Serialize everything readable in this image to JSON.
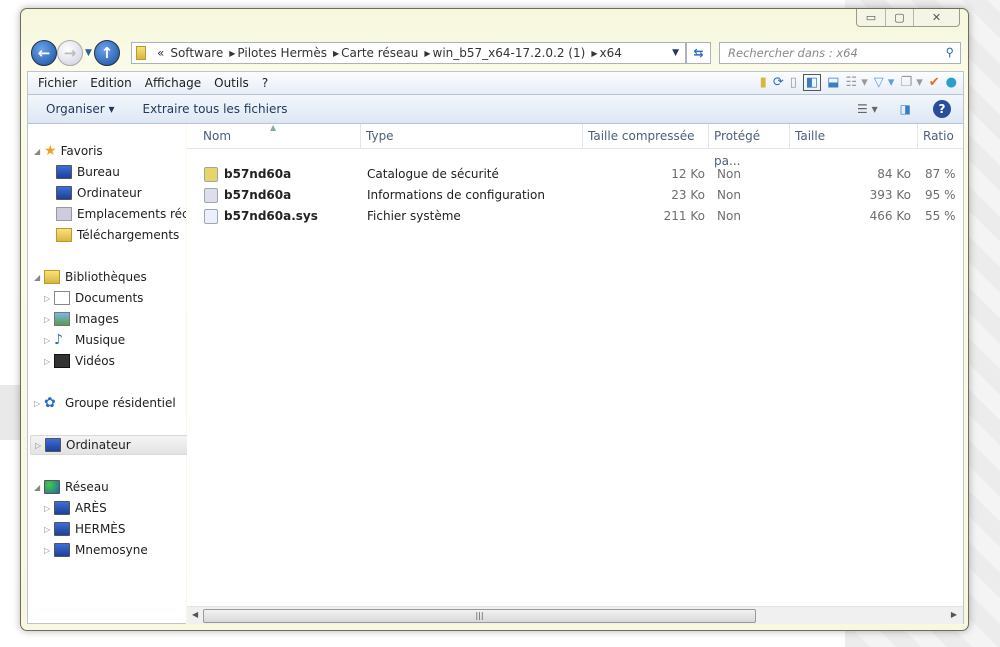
{
  "window": {
    "controls": {
      "minimize": "▭",
      "maximize": "▢",
      "close": "✕"
    }
  },
  "nav": {
    "back": "←",
    "forward": "→",
    "up": "↑"
  },
  "address": {
    "prefix": "«",
    "crumbs": [
      "Software",
      "Pilotes Hermès",
      "Carte réseau",
      "win_b57_x64-17.2.0.2 (1)",
      "x64"
    ]
  },
  "search": {
    "placeholder": "Rechercher dans : x64"
  },
  "menu": [
    "Fichier",
    "Edition",
    "Affichage",
    "Outils",
    "?"
  ],
  "commands": {
    "organize": "Organiser ▾",
    "extract": "Extraire tous les fichiers"
  },
  "sidebar": {
    "favorites": {
      "label": "Favoris",
      "items": [
        "Bureau",
        "Ordinateur",
        "Emplacements récents",
        "Téléchargements"
      ]
    },
    "libraries": {
      "label": "Bibliothèques",
      "items": [
        "Documents",
        "Images",
        "Musique",
        "Vidéos"
      ]
    },
    "homegroup": "Groupe résidentiel",
    "computer": "Ordinateur",
    "network": {
      "label": "Réseau",
      "items": [
        "ARÈS",
        "HERMÈS",
        "Mnemosyne"
      ]
    }
  },
  "columns": [
    "Nom",
    "Type",
    "Taille compressée",
    "Protégé pa...",
    "Taille",
    "Ratio"
  ],
  "files": [
    {
      "name": "b57nd60a",
      "type": "Catalogue de sécurité",
      "compressed": "12 Ko",
      "protected": "Non",
      "size": "84 Ko",
      "ratio": "87 %",
      "icon": "catalog-icon"
    },
    {
      "name": "b57nd60a",
      "type": "Informations de configuration",
      "compressed": "23 Ko",
      "protected": "Non",
      "size": "393 Ko",
      "ratio": "95 %",
      "icon": "config-file-icon"
    },
    {
      "name": "b57nd60a.sys",
      "type": "Fichier système",
      "compressed": "211 Ko",
      "protected": "Non",
      "size": "466 Ko",
      "ratio": "55 %",
      "icon": "system-file-icon"
    }
  ]
}
